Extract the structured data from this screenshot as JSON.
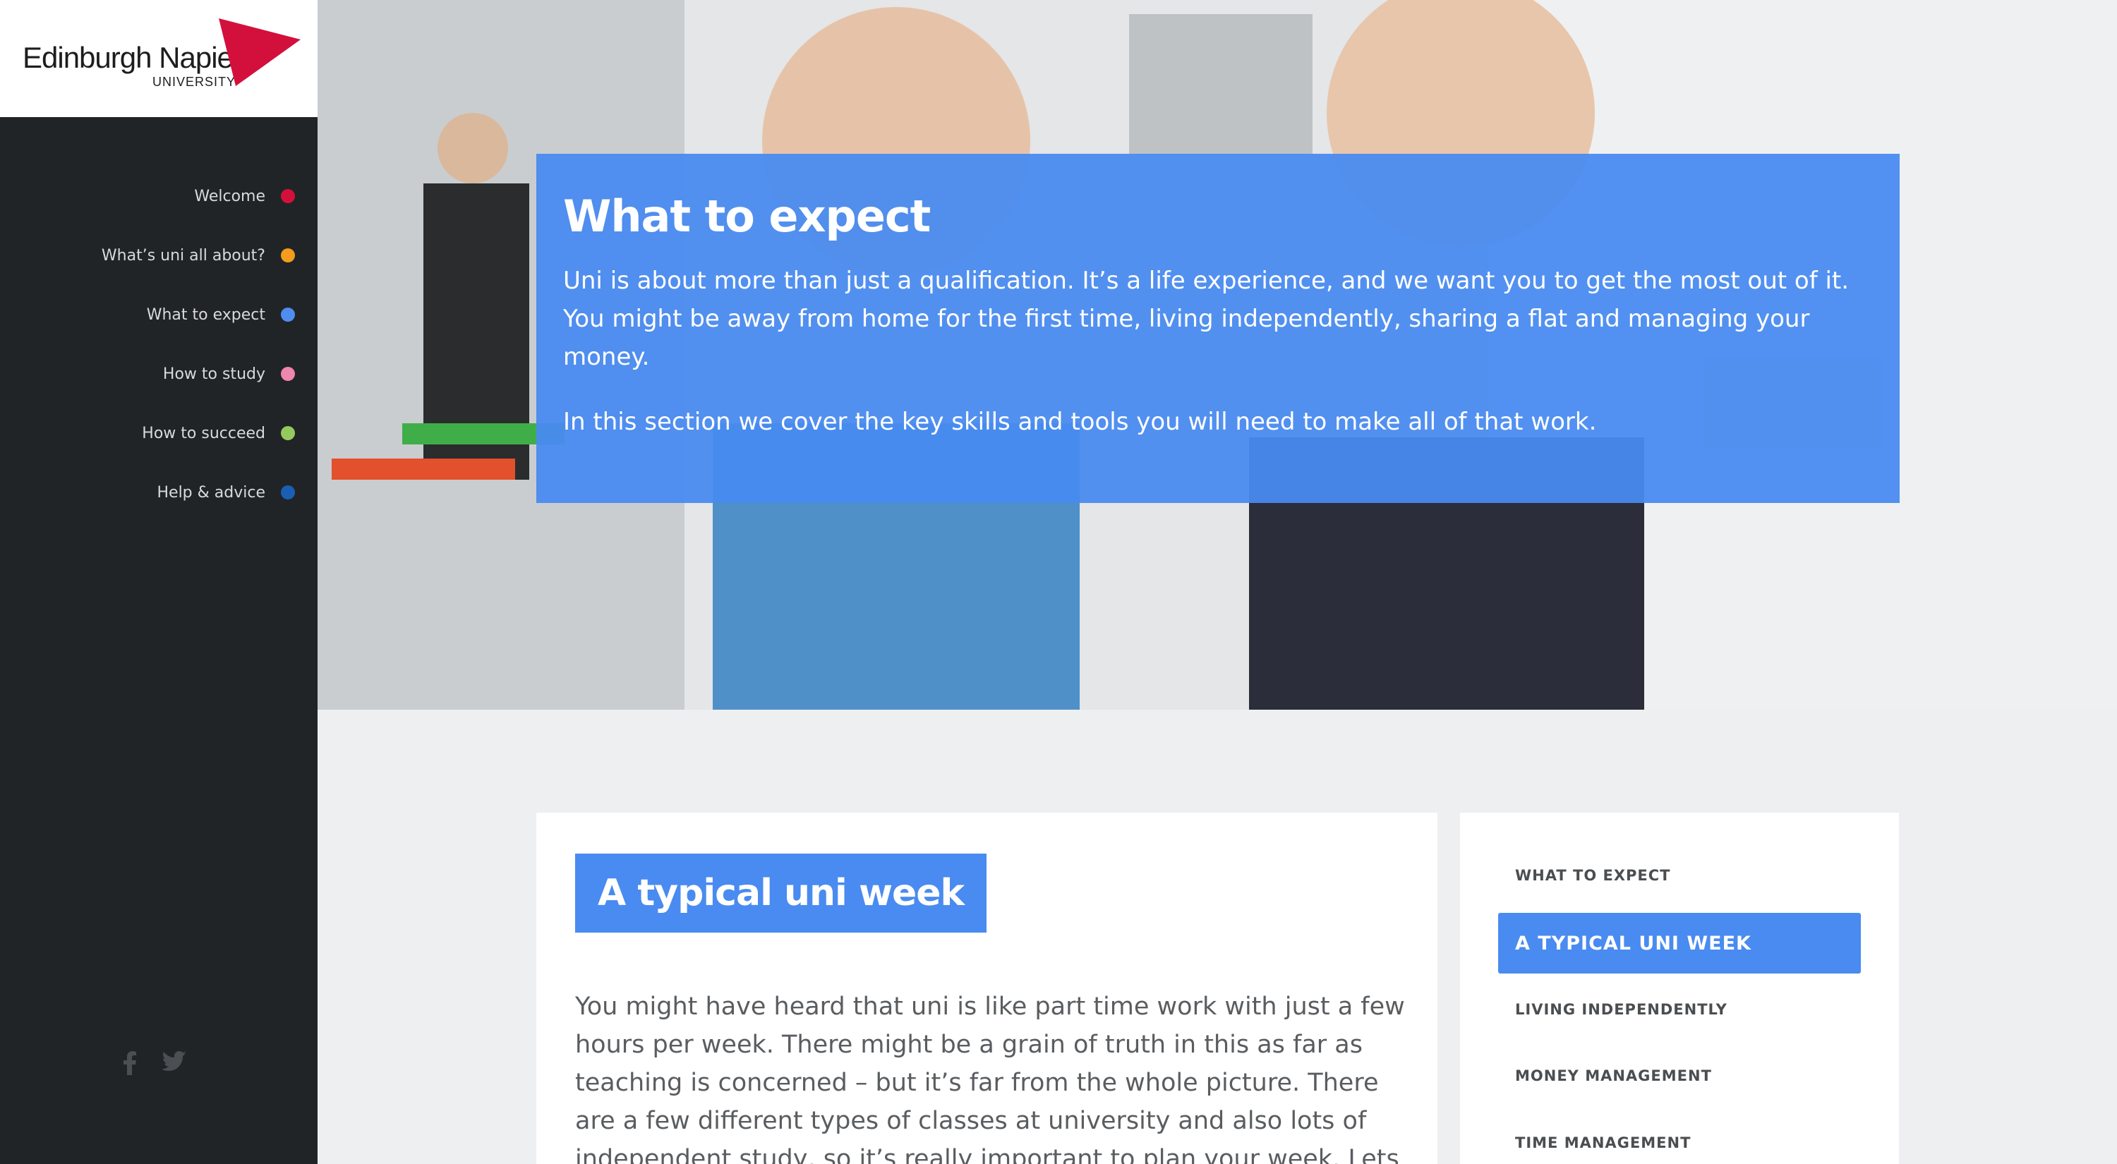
{
  "brand": {
    "name": "Edinburgh Napier",
    "sub": "UNIVERSITY",
    "accent": "#d3103c"
  },
  "sidebar": {
    "items": [
      {
        "label": "Welcome",
        "color": "#d3103c"
      },
      {
        "label": "What’s uni all about?",
        "color": "#f39c1d"
      },
      {
        "label": "What to expect",
        "color": "#4f8ef0"
      },
      {
        "label": "How to study",
        "color": "#ee86ad"
      },
      {
        "label": "How to succeed",
        "color": "#96c95d"
      },
      {
        "label": "Help & advice",
        "color": "#1a5fb4"
      }
    ],
    "social": [
      "facebook-icon",
      "twitter-icon"
    ]
  },
  "hero": {
    "title": "What to expect",
    "paragraph1": "Uni is about more than just a qualification. It’s a life experience, and we want you to get the most out of it. You might be away from home for the first time, living independently, sharing a flat and managing your money.",
    "paragraph2": "In this section we cover the key skills and tools you will need to make all of that work.",
    "panel_color": "#488af0"
  },
  "article": {
    "heading": "A typical uni week",
    "body": "You might have heard that uni is like part time work with just a few hours per week. There might be a grain of truth in this as far as teaching is concerned – but it’s far from the whole picture. There are a few different types of classes at university and also lots of independent study, so it’s really important to plan your week. Lets"
  },
  "subnav": {
    "items": [
      {
        "label": "WHAT TO EXPECT",
        "active": false
      },
      {
        "label": "A TYPICAL UNI WEEK",
        "active": true
      },
      {
        "label": "LIVING INDEPENDENTLY",
        "active": false
      },
      {
        "label": "MONEY MANAGEMENT",
        "active": false
      },
      {
        "label": "TIME MANAGEMENT",
        "active": false
      }
    ]
  }
}
